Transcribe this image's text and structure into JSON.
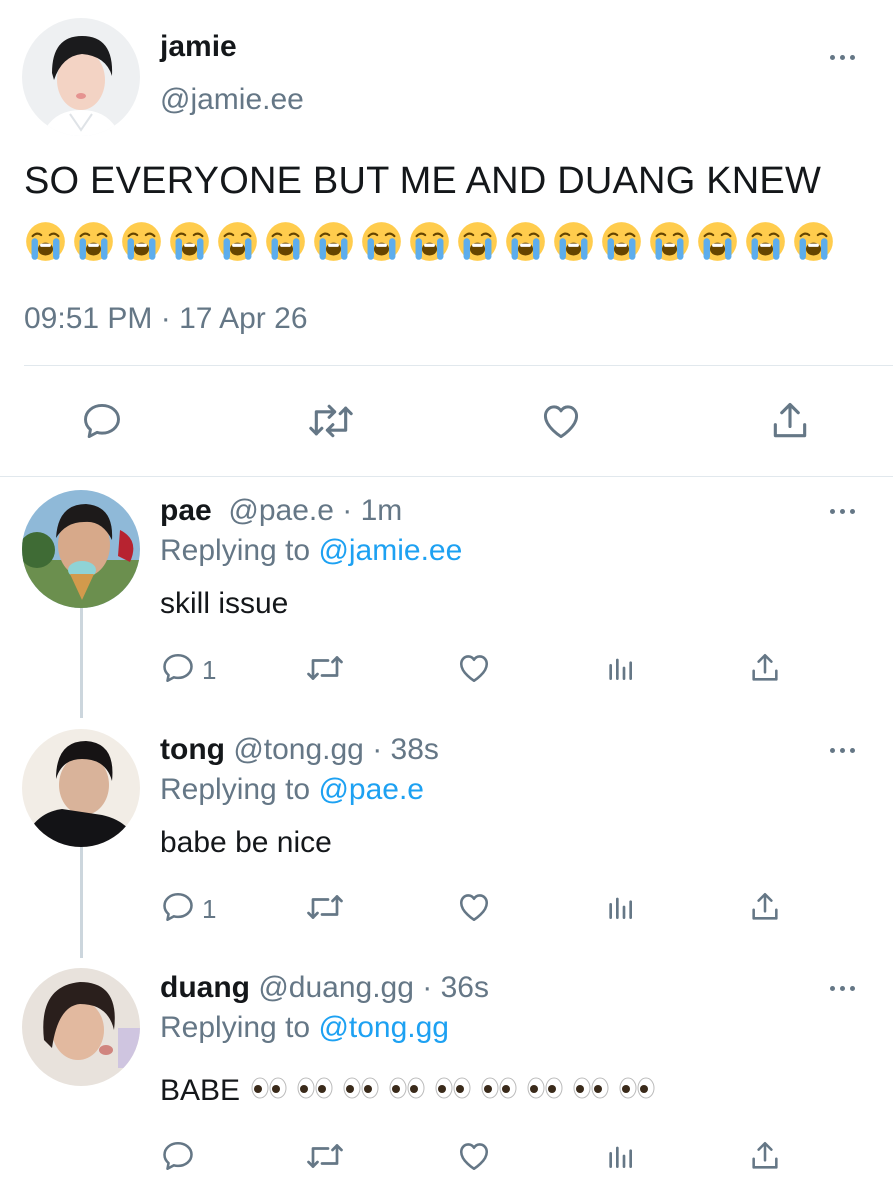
{
  "main_tweet": {
    "name": "jamie",
    "handle": "@jamie.ee",
    "text": "SO EVERYONE BUT ME AND DUANG KNEW",
    "emoji": "loudly-crying-face",
    "emoji_count": 17,
    "timestamp": "09:51 PM · 17 Apr 26"
  },
  "replies": [
    {
      "name": "pae",
      "handle": "@pae.e",
      "time": "· 1m",
      "replying_prefix": "Replying to ",
      "replying_to": "@jamie.ee",
      "text": "skill issue",
      "reply_count": "1"
    },
    {
      "name": "tong",
      "handle": "@tong.gg",
      "time": "· 38s",
      "replying_prefix": "Replying to ",
      "replying_to": "@pae.e",
      "text": "babe be nice",
      "reply_count": "1"
    },
    {
      "name": "duang",
      "handle": "@duang.gg",
      "time": "· 36s",
      "replying_prefix": "Replying to ",
      "replying_to": "@tong.gg",
      "text": "BABE",
      "emoji": "eyes",
      "emoji_count": 9,
      "reply_count": ""
    }
  ],
  "icons": [
    "reply-icon",
    "retweet-icon",
    "like-icon",
    "analytics-icon",
    "share-icon",
    "more-icon"
  ],
  "colors": {
    "link": "#1da1f2",
    "muted": "#657786",
    "divider": "#e1e8ed"
  }
}
